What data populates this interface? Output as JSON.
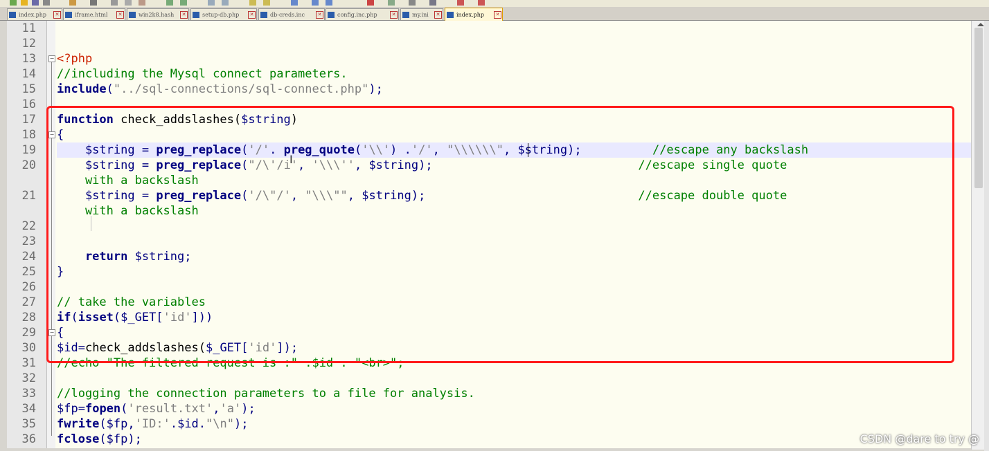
{
  "tabs": [
    {
      "label": "index.php"
    },
    {
      "label": "iframe.html"
    },
    {
      "label": "win2k8.hash"
    },
    {
      "label": "setup-db.php"
    },
    {
      "label": "db-creds.inc"
    },
    {
      "label": "config.inc.php"
    },
    {
      "label": "my.ini"
    },
    {
      "label": "index.php",
      "active": true
    }
  ],
  "editor": {
    "line_numbers": [
      "11",
      "12",
      "13",
      "14",
      "15",
      "16",
      "17",
      "18",
      "19",
      "20",
      "21",
      "22",
      "23",
      "24",
      "25",
      "26",
      "27",
      "28",
      "29",
      "30",
      "31",
      "32",
      "33",
      "34",
      "35",
      "36"
    ],
    "current_line": "19",
    "highlight_box_color": "#ff1a1a"
  },
  "watermark": "CSDN @dare to try @",
  "colors": {
    "keyword": "#000080",
    "comment": "#008000",
    "string": "#808080",
    "php_tag": "#cc2200"
  }
}
